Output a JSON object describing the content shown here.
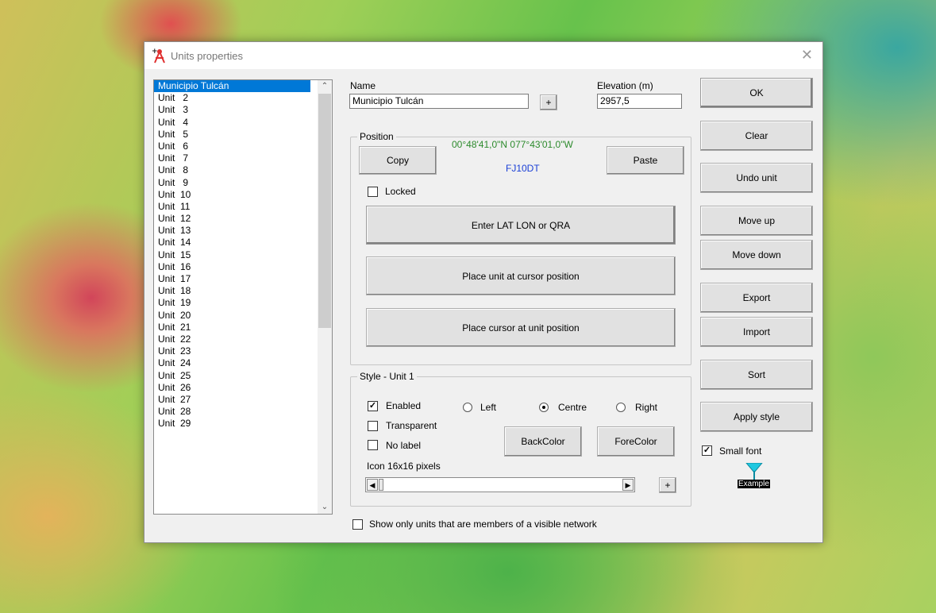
{
  "window": {
    "title": "Units properties",
    "close_symbol": "✕"
  },
  "units_list": {
    "items": [
      "Municipio Tulcán",
      "Unit   2",
      "Unit   3",
      "Unit   4",
      "Unit   5",
      "Unit   6",
      "Unit   7",
      "Unit   8",
      "Unit   9",
      "Unit  10",
      "Unit  11",
      "Unit  12",
      "Unit  13",
      "Unit  14",
      "Unit  15",
      "Unit  16",
      "Unit  17",
      "Unit  18",
      "Unit  19",
      "Unit  20",
      "Unit  21",
      "Unit  22",
      "Unit  23",
      "Unit  24",
      "Unit  25",
      "Unit  26",
      "Unit  27",
      "Unit  28",
      "Unit  29"
    ],
    "selected_index": 0,
    "scroll_up": "⌃",
    "scroll_down": "⌄"
  },
  "name_field": {
    "label": "Name",
    "value": "Municipio Tulcán",
    "plus": "+"
  },
  "elevation": {
    "label": "Elevation (m)",
    "value": "2957,5"
  },
  "position": {
    "title": "Position",
    "copy": "Copy",
    "paste": "Paste",
    "coordinates": "00°48'41,0\"N 077°43'01,0\"W",
    "locator": "FJ10DT",
    "locked_label": "Locked",
    "locked": false,
    "enter_btn": "Enter LAT LON or QRA",
    "place_unit_btn": "Place unit at cursor position",
    "place_cursor_btn": "Place cursor at unit position"
  },
  "style": {
    "title": "Style - Unit   1",
    "enabled_label": "Enabled",
    "enabled": true,
    "transparent_label": "Transparent",
    "nolabel_label": "No label",
    "align_left": "Left",
    "align_centre": "Centre",
    "align_right": "Right",
    "selected_alignment": "Centre",
    "backcolor": "BackColor",
    "forecolor": "ForeColor",
    "icon_label": "Icon 16x16 pixels",
    "icon_plus": "+"
  },
  "show_only": {
    "label": "Show only units that are members of a visible network",
    "checked": false
  },
  "right_buttons": {
    "ok": "OK",
    "clear": "Clear",
    "undo": "Undo unit",
    "move_up": "Move up",
    "move_down": "Move down",
    "export": "Export",
    "import": "Import",
    "sort": "Sort",
    "apply_style": "Apply style"
  },
  "small_font": {
    "label": "Small font",
    "checked": true
  },
  "example": {
    "label": "Example",
    "marker_color": "#1fc8e0"
  },
  "colors": {
    "selection": "#0078d7",
    "coords": "#2c8a2c",
    "locator": "#1a3fd6"
  }
}
